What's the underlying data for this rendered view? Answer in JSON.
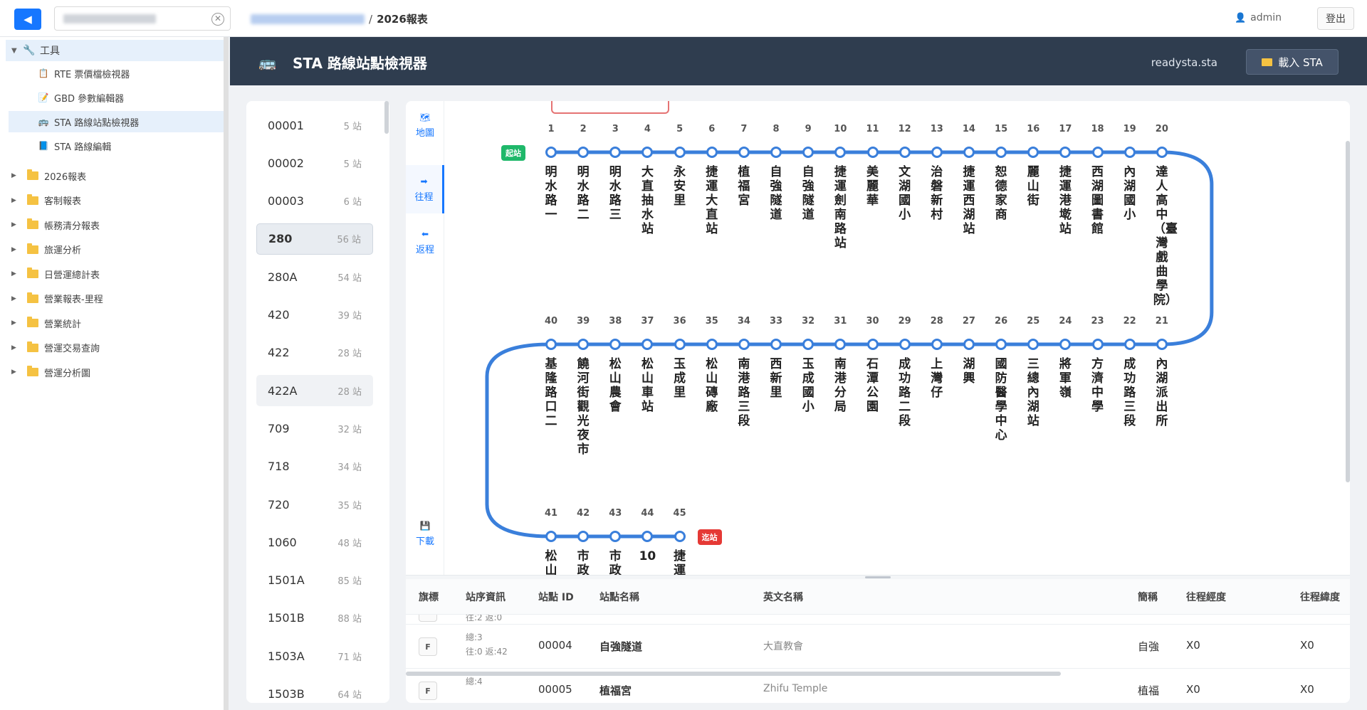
{
  "topbar": {
    "back_icon": "◀",
    "breadcrumb_sep": "/",
    "breadcrumb_current": "2026報表",
    "user_name": "admin",
    "logout_label": "登出"
  },
  "sidebar": {
    "tools_label": "工具",
    "tools": [
      {
        "label": "RTE 票價檔檢視器",
        "icon": "📋"
      },
      {
        "label": "GBD 參數編輯器",
        "icon": "📝"
      },
      {
        "label": "STA 路線站點檢視器",
        "icon": "🚌"
      },
      {
        "label": "STA 路線編輯",
        "icon": "📘"
      }
    ],
    "folders": [
      "2026報表",
      "客制報表",
      "帳務清分報表",
      "旅運分析",
      "日營運總計表",
      "營業報表-里程",
      "營業統計",
      "營運交易查詢",
      "營運分析圖"
    ]
  },
  "header": {
    "icon": "🚌",
    "title": "STA 路線站點檢視器",
    "filename": "readysta.sta",
    "load_label": "載入 STA"
  },
  "routes": [
    {
      "code": "00001",
      "count": "5 站"
    },
    {
      "code": "00002",
      "count": "5 站"
    },
    {
      "code": "00003",
      "count": "6 站"
    },
    {
      "code": "280",
      "count": "56 站"
    },
    {
      "code": "280A",
      "count": "54 站"
    },
    {
      "code": "420",
      "count": "39 站"
    },
    {
      "code": "422",
      "count": "28 站"
    },
    {
      "code": "422A",
      "count": "28 站"
    },
    {
      "code": "709",
      "count": "32 站"
    },
    {
      "code": "718",
      "count": "34 站"
    },
    {
      "code": "720",
      "count": "35 站"
    },
    {
      "code": "1060",
      "count": "48 站"
    },
    {
      "code": "1501A",
      "count": "85 站"
    },
    {
      "code": "1501B",
      "count": "88 站"
    },
    {
      "code": "1503A",
      "count": "71 站"
    },
    {
      "code": "1503B",
      "count": "64 站"
    }
  ],
  "tabs": [
    {
      "label": "地圖",
      "icon": "🗺"
    },
    {
      "label": "往程",
      "icon": "➡"
    },
    {
      "label": "返程",
      "icon": "⬅"
    },
    {
      "label": "下載",
      "icon": "💾"
    }
  ],
  "map": {
    "start_badge": "起站",
    "end_badge": "迄站",
    "row1": [
      {
        "n": "1",
        "name": "明水路一"
      },
      {
        "n": "2",
        "name": "明水路二"
      },
      {
        "n": "3",
        "name": "明水路三"
      },
      {
        "n": "4",
        "name": "大直抽水站"
      },
      {
        "n": "5",
        "name": "永安里"
      },
      {
        "n": "6",
        "name": "捷運大直站"
      },
      {
        "n": "7",
        "name": "植福宮"
      },
      {
        "n": "8",
        "name": "自強隧道"
      },
      {
        "n": "9",
        "name": "自強隧道"
      },
      {
        "n": "10",
        "name": "捷運劍南路站"
      },
      {
        "n": "11",
        "name": "美麗華"
      },
      {
        "n": "12",
        "name": "文湖國小"
      },
      {
        "n": "13",
        "name": "治磐新村"
      },
      {
        "n": "14",
        "name": "捷運西湖站"
      },
      {
        "n": "15",
        "name": "恕德家商"
      },
      {
        "n": "16",
        "name": "麗山街"
      },
      {
        "n": "17",
        "name": "捷運港墘站"
      },
      {
        "n": "18",
        "name": "西湖圖書館"
      },
      {
        "n": "19",
        "name": "內湖國小"
      },
      {
        "n": "20",
        "name": "達人高中（臺灣戲曲學院）"
      }
    ],
    "row2": [
      {
        "n": "40",
        "name": "基隆路口二"
      },
      {
        "n": "39",
        "name": "饒河街觀光夜市"
      },
      {
        "n": "38",
        "name": "松山農會"
      },
      {
        "n": "37",
        "name": "松山車站"
      },
      {
        "n": "36",
        "name": "玉成里"
      },
      {
        "n": "35",
        "name": "松山磚廠"
      },
      {
        "n": "34",
        "name": "南港路三段"
      },
      {
        "n": "33",
        "name": "西新里"
      },
      {
        "n": "32",
        "name": "玉成國小"
      },
      {
        "n": "31",
        "name": "南港分局"
      },
      {
        "n": "30",
        "name": "石潭公園"
      },
      {
        "n": "29",
        "name": "成功路二段"
      },
      {
        "n": "28",
        "name": "上灣仔"
      },
      {
        "n": "27",
        "name": "湖興"
      },
      {
        "n": "26",
        "name": "國防醫學中心"
      },
      {
        "n": "25",
        "name": "三總內湖站"
      },
      {
        "n": "24",
        "name": "將軍嶺"
      },
      {
        "n": "23",
        "name": "方濟中學"
      },
      {
        "n": "22",
        "name": "成功路三段"
      },
      {
        "n": "21",
        "name": "內湖派出所"
      }
    ],
    "row3": [
      {
        "n": "41",
        "name": "松山"
      },
      {
        "n": "42",
        "name": "市政"
      },
      {
        "n": "43",
        "name": "市政"
      },
      {
        "n": "44",
        "name": "10"
      },
      {
        "n": "45",
        "name": "捷運"
      }
    ]
  },
  "table": {
    "headers": [
      "旗標",
      "站序資訊",
      "站點 ID",
      "站點名稱",
      "英文名稱",
      "簡稱",
      "往程經度",
      "往程緯度"
    ],
    "partial_row_seq": "往:2 返:0",
    "rows": [
      {
        "flag": "F",
        "seq1": "總:3",
        "seq2": "往:0 返:42",
        "id": "00004",
        "name": "自強隧道",
        "en": "大直教會",
        "abbr": "自強",
        "lon": "X0",
        "lat": "X0"
      },
      {
        "flag": "F",
        "seq1": "總:4",
        "seq2": "",
        "id": "00005",
        "name": "植福宮",
        "en": "Zhifu Temple",
        "abbr": "植福",
        "lon": "X0",
        "lat": "X0"
      }
    ]
  },
  "colors": {
    "accent": "#1677ff",
    "route_line": "#3a7fdb",
    "header_bg": "#2f3d4f",
    "start_badge": "#1fb86a",
    "end_badge": "#e53935"
  }
}
